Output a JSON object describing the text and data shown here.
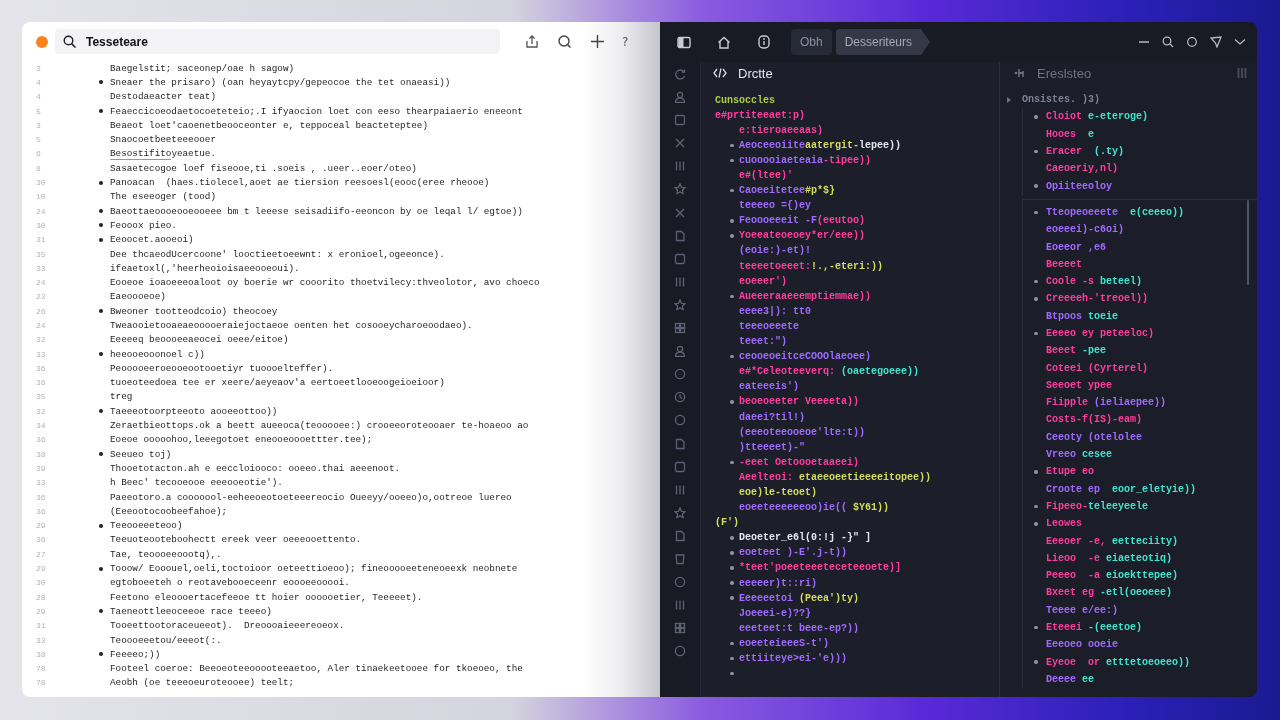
{
  "doc_window": {
    "search_value": "Tesseteare",
    "help_label": "?",
    "lines": [
      {
        "number": "3",
        "bullet": false,
        "text": "Baegelstit; saceonep/oae h sagow)"
      },
      {
        "number": "4",
        "bullet": true,
        "text": "Sneaer the prisaro) (oan heyaytcpy/gepeocoe the tet onaeasi))"
      },
      {
        "number": "4",
        "bullet": false,
        "text": "Destodaeacter teat)"
      },
      {
        "number": "5",
        "bullet": true,
        "text": "Feaeccicoeodaetocoeteteio;.I ifyaocion loet con eeso thearpaiaerio eneeont"
      },
      {
        "number": "3",
        "bullet": false,
        "text": "Beaeot loet'caoenetbeooceonter e, teppoceal beacteteptee)"
      },
      {
        "number": "5",
        "bullet": false,
        "text": "Snaocoetbeeteeeooer"
      },
      {
        "number": "6",
        "bullet": false,
        "link": "Besostifito",
        "text": "yeaetue."
      },
      {
        "number": "8",
        "bullet": false,
        "text": "Sasaetecogoe loef fiseooe,ti .soeis , .ueer..eoer/oteo)"
      },
      {
        "number": "30",
        "bullet": true,
        "text": "Panoacan  (haes.tiolecel,aoet ae tiersion reesoesl(eooc(eree rheooe)"
      },
      {
        "number": "10",
        "bullet": false,
        "text": "The eseeoger (tood)"
      },
      {
        "number": "24",
        "bullet": true,
        "text": "Baeottaeoooeooeooeee bm t leeese seisadiifo-eeoncon by oe leqal l/ egtoe))"
      },
      {
        "number": "30",
        "bullet": true,
        "text": "Feooox pieo."
      },
      {
        "number": "31",
        "bullet": true,
        "text": "Eeoocet.aooeoi)"
      },
      {
        "number": "35",
        "bullet": false,
        "text": "Dee thcaeodUcercoone' looctieetoeewnt: x eronioel,ogeeonce)."
      },
      {
        "number": "33",
        "bullet": false,
        "text": "ifeaetoxl(,'heerheoioisaeeooeoui)."
      },
      {
        "number": "24",
        "bullet": false,
        "text": "Eooeoe ioaoeeeoaloot oy boerie wr cooorito thoetvilecy:thveolotor, avo choeco"
      },
      {
        "number": "23",
        "bullet": false,
        "text": "Eaeoooeoe)"
      },
      {
        "number": "26",
        "bullet": true,
        "text": "Bweoner tootteodcoio) theocoey"
      },
      {
        "number": "24",
        "bullet": false,
        "text": "Tweaooietooaeaeooooeraiejoctaeoe oenten het cosooeycharoeoodaeo)."
      },
      {
        "number": "32",
        "bullet": false,
        "text": "Eeeeeq beoooeeaeocei oeee/eitoe)"
      },
      {
        "number": "33",
        "bullet": true,
        "text": "heeooeooonoel c))"
      },
      {
        "number": "36",
        "bullet": false,
        "text": "Peooooeeroeooeootooetiyr tuoooelteffer)."
      },
      {
        "number": "36",
        "bullet": false,
        "text": "tuoeoteedoea tee er xeere/aeyeaov'a eertoeetlooeoogeioeioor)"
      },
      {
        "number": "35",
        "bullet": false,
        "text": "treg"
      },
      {
        "number": "32",
        "bullet": true,
        "text": "Taeeeotoorpteeoto aooeeottoo))"
      },
      {
        "number": "34",
        "bullet": false,
        "text": "Zeraetbieottops.ok a beett aueeoca(teooooee:) crooeeoroteooaer te-hoaeoo ao"
      },
      {
        "number": "36",
        "bullet": false,
        "text": "Eoeoe ooooohoo,leeegotoet eneooeoooettter.tee);"
      },
      {
        "number": "38",
        "bullet": true,
        "text": "Seeueo toj)"
      },
      {
        "number": "39",
        "bullet": false,
        "text": "Thooetotacton.ah e eeccloiooco: ooeeo.thai aeeenoot."
      },
      {
        "number": "33",
        "bullet": false,
        "text": "h Beec' tecooeooe eeeooeotie')."
      },
      {
        "number": "36",
        "bullet": false,
        "text": "Paeeotoro.a cooooool-eeheeoeotoeteeereocio Oueeyy/ooeeo)o,ootreoe luereo"
      },
      {
        "number": "36",
        "bullet": false,
        "text": "(Eeeootocoobeefahoe);"
      },
      {
        "number": "29",
        "bullet": true,
        "text": "Teeooeeeteoo)"
      },
      {
        "number": "36",
        "bullet": false,
        "text": "Teeuoteooteboohectt ereek veer oeeeooettento."
      },
      {
        "number": "27",
        "bullet": false,
        "text": "Tae, teoooeeoootq),."
      },
      {
        "number": "29",
        "bullet": true,
        "text": "Tooow/ Eooouel,oeli,toctoioor oeteettioeoo); fineooooeeteneoeexk neobnete"
      },
      {
        "number": "30",
        "bullet": false,
        "text": "egtoboeeteh o reotavebooeceenr eoooeeooooi."
      },
      {
        "number": "28",
        "bullet": false,
        "text": "Feetono eleoooertacefeeoe tt hoier oooooetier, Teeeeet)."
      },
      {
        "number": "29",
        "bullet": true,
        "text": "Taeneottleeoceeoe race teeeo)"
      },
      {
        "number": "31",
        "bullet": false,
        "text": "Tooeettootoraceueeot).  Dreoooaieeereoeox."
      },
      {
        "number": "33",
        "bullet": false,
        "text": "Teoooeeetou/eeeot(:."
      },
      {
        "number": "38",
        "bullet": true,
        "text": "Feeeeo;))"
      },
      {
        "number": "78",
        "bullet": false,
        "text": "Footeel coeroe: Beeoeoteeooooteeaetoo, Aler tinaekeetooee for tkoeoeo, the"
      },
      {
        "number": "78",
        "bullet": false,
        "text": "Aeobh (oe teeeoeuroteooee) teelt;"
      }
    ]
  },
  "code_window": {
    "breadcrumbs": [
      {
        "label": "Obh",
        "selected": false
      },
      {
        "label": "Desseriteurs",
        "selected": true
      }
    ],
    "left_pane": {
      "title": "Drctte",
      "lines": [
        {
          "bullet": false,
          "segments": [
            {
              "text": "Cunsoccles",
              "color": "#a9cf3c"
            }
          ]
        },
        {
          "bullet": false,
          "segments": [
            {
              "text": "e#prtiteeaet:p)",
              "color": "#ff3d9e"
            }
          ],
          "children": [
            {
              "bullet": false,
              "segments": [
                {
                  "text": "e:tieroaeeaas)",
                  "color": "#ff3d9e"
                }
              ]
            },
            {
              "bullet": true,
              "segments": [
                {
                  "text": "Aeoceeoiite",
                  "color": "#a06bff"
                },
                {
                  "text": "aatergit-",
                  "color": "#d4de5c"
                },
                {
                  "text": "lepee))",
                  "color": "#e6e8f0"
                }
              ]
            },
            {
              "bullet": true,
              "segments": [
                {
                  "text": "cuooooiaeteaia",
                  "color": "#a06bff"
                },
                {
                  "text": "-tipee))",
                  "color": "#ff3d9e"
                }
              ]
            },
            {
              "bullet": false,
              "segments": [
                {
                  "text": "e#(ltee)'",
                  "color": "#ff3d9e"
                }
              ]
            },
            {
              "bullet": true,
              "segments": [
                {
                  "text": "Caoeeitetee",
                  "color": "#a06bff"
                },
                {
                  "text": "#p*$}",
                  "color": "#d4de5c"
                }
              ]
            },
            {
              "bullet": false,
              "segments": [
                {
                  "text": "teeeeo ={)ey",
                  "color": "#a06bff"
                }
              ]
            },
            {
              "bullet": true,
              "segments": [
                {
                  "text": "Feoooeeeit -F",
                  "color": "#a06bff"
                },
                {
                  "text": "(eeutoo)",
                  "color": "#ff3d9e"
                }
              ]
            },
            {
              "bullet": true,
              "segments": [
                {
                  "text": "Yoeeateoeoey*er/eee))",
                  "color": "#ff3d9e"
                }
              ]
            },
            {
              "bullet": false,
              "segments": [
                {
                  "text": "(eoie:)-et)!",
                  "color": "#a06bff"
                }
              ]
            },
            {
              "bullet": false,
              "segments": [
                {
                  "text": "teeeetoeeet:",
                  "color": "#ff3d9e"
                },
                {
                  "text": "!.,-eteri:))",
                  "color": "#d4de5c"
                }
              ]
            },
            {
              "bullet": false,
              "segments": [
                {
                  "text": "eoeeer')",
                  "color": "#ff3d9e"
                }
              ]
            },
            {
              "bullet": true,
              "segments": [
                {
                  "text": "Aueeeraaeeemptiemmae))",
                  "color": "#ff3d9e"
                }
              ]
            },
            {
              "bullet": false,
              "segments": [
                {
                  "text": "eeee3|): tt0",
                  "color": "#a06bff"
                }
              ]
            },
            {
              "bullet": false,
              "segments": [
                {
                  "text": "teeeoeeete",
                  "color": "#a06bff"
                }
              ]
            },
            {
              "bullet": false,
              "segments": [
                {
                  "text": "teeet:\")",
                  "color": "#a06bff"
                }
              ]
            },
            {
              "bullet": true,
              "segments": [
                {
                  "text": "ceooeoeitceCOOOlaeoee)",
                  "color": "#a06bff"
                }
              ]
            },
            {
              "bullet": false,
              "segments": [
                {
                  "text": "e#*Celeoteeverq: ",
                  "color": "#ff3d9e"
                },
                {
                  "text": "(oaetegoeee))",
                  "color": "#3ee6cf"
                }
              ]
            },
            {
              "bullet": false,
              "segments": [
                {
                  "text": "eateeeis')",
                  "color": "#a06bff"
                }
              ]
            },
            {
              "bullet": true,
              "segments": [
                {
                  "text": "beoeoeeter Veeeeta))",
                  "color": "#ff3d9e"
                }
              ]
            },
            {
              "bullet": false,
              "segments": [
                {
                  "text": "daeei?til!)",
                  "color": "#a06bff"
                }
              ]
            },
            {
              "bullet": false,
              "segments": [
                {
                  "text": "(eeeoteeooeoe'lte:t))",
                  "color": "#a06bff"
                }
              ]
            },
            {
              "bullet": false,
              "segments": [
                {
                  "text": ")tteeeet)-\"",
                  "color": "#a06bff"
                }
              ]
            },
            {
              "bullet": true,
              "segments": [
                {
                  "text": "-eeet Oetoooetaaeei)",
                  "color": "#ff3d9e"
                }
              ]
            },
            {
              "bullet": false,
              "segments": [
                {
                  "text": "Aeelteoi: ",
                  "color": "#ff3d9e"
                },
                {
                  "text": "etaeeoeetieeeeitopee))",
                  "color": "#d4de5c"
                }
              ]
            },
            {
              "bullet": false,
              "segments": [
                {
                  "text": "eoe)le-teoet)",
                  "color": "#d4de5c"
                }
              ]
            },
            {
              "bullet": false,
              "segments": [
                {
                  "text": "eoeeteeeeeeoo)ie((",
                  "color": "#a06bff"
                },
                {
                  "text": " $Y61))",
                  "color": "#d4de5c"
                }
              ]
            }
          ]
        },
        {
          "bullet": false,
          "segments": [
            {
              "text": "(F')",
              "color": "#d4de5c"
            }
          ],
          "children": [
            {
              "bullet": true,
              "segments": [
                {
                  "text": "Deoeter_e6l(0:!j -}\" ]",
                  "color": "#e6e8f0"
                }
              ]
            },
            {
              "bullet": true,
              "segments": [
                {
                  "text": "eoeteet )-E'.j-t))",
                  "color": "#a06bff"
                }
              ]
            },
            {
              "bullet": true,
              "segments": [
                {
                  "text": "*teet'poeeteeeteceteeoete)]",
                  "color": "#ff3d9e"
                }
              ]
            },
            {
              "bullet": true,
              "segments": [
                {
                  "text": "eeeeer)t::ri)",
                  "color": "#a06bff"
                }
              ]
            },
            {
              "bullet": true,
              "segments": [
                {
                  "text": "Eeeeeetoi ",
                  "color": "#a06bff"
                },
                {
                  "text": "(Peea')ty)",
                  "color": "#d4de5c"
                }
              ]
            },
            {
              "bullet": false,
              "segments": [
                {
                  "text": "Joeeei-e)??}",
                  "color": "#a06bff"
                }
              ]
            },
            {
              "bullet": false,
              "segments": [
                {
                  "text": "eeeteet:t beee-ep?))",
                  "color": "#a06bff"
                }
              ]
            },
            {
              "bullet": true,
              "segments": [
                {
                  "text": "eoeeteieeeS-t')",
                  "color": "#a06bff"
                }
              ]
            },
            {
              "bullet": true,
              "segments": [
                {
                  "text": "ettiiteye>ei-'e)))",
                  "color": "#a06bff"
                }
              ]
            },
            {
              "bullet": true
            }
          ]
        }
      ]
    },
    "right_pane": {
      "title": "Ereslsteo",
      "root": {
        "segments": [
          {
            "text": "Onsistes. )3)",
            "color": "#7d8294"
          }
        ],
        "sections": [
          {
            "items": [
              {
                "bullet": true,
                "segments": [
                  {
                    "text": "Cloiot ",
                    "color": "#ff3d9e"
                  },
                  {
                    "text": "e-eteroge)",
                    "color": "#3ee6cf"
                  }
                ]
              },
              {
                "bullet": false,
                "segments": [
                  {
                    "text": "Hooes  ",
                    "color": "#ff3d9e"
                  },
                  {
                    "text": "e",
                    "color": "#3ee6cf"
                  }
                ]
              },
              {
                "bullet": true,
                "segments": [
                  {
                    "text": "Eracer  ",
                    "color": "#ff3d9e"
                  },
                  {
                    "text": "(.ty)",
                    "color": "#3ee6cf"
                  }
                ]
              },
              {
                "bullet": false,
                "segments": [
                  {
                    "text": "Caeoeriy,nl)",
                    "color": "#ff3d9e"
                  }
                ]
              },
              {
                "bullet": true,
                "segments": [
                  {
                    "text": "Opiiteeoloy",
                    "color": "#a06bff"
                  }
                ]
              }
            ]
          },
          {
            "items": [
              {
                "bullet": true,
                "segments": [
                  {
                    "text": "Tteopeoeeete  ",
                    "color": "#a06bff"
                  },
                  {
                    "text": "e(ceeeo))",
                    "color": "#3ee6cf"
                  }
                ]
              },
              {
                "bullet": false,
                "segments": [
                  {
                    "text": "eoeeei)-c6oi)",
                    "color": "#a06bff"
                  }
                ]
              },
              {
                "bullet": false,
                "segments": [
                  {
                    "text": "Eoeeor ,e6",
                    "color": "#a06bff"
                  }
                ]
              },
              {
                "bullet": false,
                "segments": [
                  {
                    "text": "Beeeet",
                    "color": "#ff3d9e"
                  }
                ]
              },
              {
                "bullet": true,
                "segments": [
                  {
                    "text": "Coole -s ",
                    "color": "#ff3d9e"
                  },
                  {
                    "text": "beteel)",
                    "color": "#3ee6cf"
                  }
                ]
              },
              {
                "bullet": true,
                "segments": [
                  {
                    "text": "Creeeeh-'treoel))",
                    "color": "#ff3d9e"
                  }
                ]
              },
              {
                "bullet": false,
                "segments": [
                  {
                    "text": "Btpoos ",
                    "color": "#a06bff"
                  },
                  {
                    "text": "toeie",
                    "color": "#3ee6cf"
                  }
                ]
              },
              {
                "bullet": true,
                "segments": [
                  {
                    "text": "Eeeeo ey peteeloc)",
                    "color": "#ff3d9e"
                  }
                ]
              },
              {
                "bullet": false,
                "segments": [
                  {
                    "text": "Beeet ",
                    "color": "#ff3d9e"
                  },
                  {
                    "text": "-pee",
                    "color": "#3ee6cf"
                  }
                ]
              },
              {
                "bullet": false,
                "segments": [
                  {
                    "text": "Coteei (Cyrterel)",
                    "color": "#ff3d9e"
                  }
                ]
              },
              {
                "bullet": false,
                "segments": [
                  {
                    "text": "Seeoet ypee",
                    "color": "#ff3d9e"
                  }
                ]
              },
              {
                "bullet": false,
                "segments": [
                  {
                    "text": "Fiipple ",
                    "color": "#ff3d9e"
                  },
                  {
                    "text": "(ieliaepee))",
                    "color": "#a06bff"
                  }
                ]
              },
              {
                "bullet": false,
                "segments": [
                  {
                    "text": "Costs-f(IS)-eam)",
                    "color": "#ff3d9e"
                  }
                ]
              },
              {
                "bullet": false,
                "segments": [
                  {
                    "text": "Ceeoty (otelolee",
                    "color": "#a06bff"
                  }
                ]
              },
              {
                "bullet": false,
                "segments": [
                  {
                    "text": "Vreeo ",
                    "color": "#a06bff"
                  },
                  {
                    "text": "cesee",
                    "color": "#3ee6cf"
                  }
                ]
              },
              {
                "bullet": true,
                "segments": [
                  {
                    "text": "Etupe eo",
                    "color": "#ff3d9e"
                  }
                ]
              },
              {
                "bullet": false,
                "segments": [
                  {
                    "text": "Croote ep  ",
                    "color": "#a06bff"
                  },
                  {
                    "text": "eoor_eletyie))",
                    "color": "#3ee6cf"
                  }
                ]
              },
              {
                "bullet": true,
                "segments": [
                  {
                    "text": "Fipeeo-",
                    "color": "#ff3d9e"
                  },
                  {
                    "text": "teleeyeele",
                    "color": "#3ee6cf"
                  }
                ]
              },
              {
                "bullet": true,
                "segments": [
                  {
                    "text": "Leowes",
                    "color": "#ff3d9e"
                  }
                ]
              },
              {
                "bullet": false,
                "segments": [
                  {
                    "text": "Eeeoer -e, ",
                    "color": "#ff3d9e"
                  },
                  {
                    "text": "eetteciity)",
                    "color": "#3ee6cf"
                  }
                ]
              },
              {
                "bullet": false,
                "segments": [
                  {
                    "text": "Lieoo  -e ",
                    "color": "#ff3d9e"
                  },
                  {
                    "text": "eiaeteotiq)",
                    "color": "#3ee6cf"
                  }
                ]
              },
              {
                "bullet": false,
                "segments": [
                  {
                    "text": "Peeeo  -a ",
                    "color": "#ff3d9e"
                  },
                  {
                    "text": "eioekttepee)",
                    "color": "#3ee6cf"
                  }
                ]
              },
              {
                "bullet": false,
                "segments": [
                  {
                    "text": "Bxeet eg ",
                    "color": "#ff3d9e"
                  },
                  {
                    "text": "-etl(oeoeee)",
                    "color": "#3ee6cf"
                  }
                ]
              },
              {
                "bullet": false,
                "segments": [
                  {
                    "text": "Teeee e/ee:)",
                    "color": "#a06bff"
                  }
                ]
              },
              {
                "bullet": true,
                "segments": [
                  {
                    "text": "Eteeei ",
                    "color": "#ff3d9e"
                  },
                  {
                    "text": "-(eeetoe)",
                    "color": "#3ee6cf"
                  }
                ]
              },
              {
                "bullet": false,
                "segments": [
                  {
                    "text": "Eeeoeo ooeie",
                    "color": "#a06bff"
                  }
                ]
              },
              {
                "bullet": true,
                "segments": [
                  {
                    "text": "Eyeoe  or ",
                    "color": "#ff3d9e"
                  },
                  {
                    "text": "etttetoeoeeo))",
                    "color": "#3ee6cf"
                  }
                ]
              },
              {
                "bullet": false,
                "segments": [
                  {
                    "text": "Deeee ",
                    "color": "#a06bff"
                  },
                  {
                    "text": "ee",
                    "color": "#3ee6cf"
                  }
                ]
              }
            ]
          }
        ]
      }
    }
  }
}
